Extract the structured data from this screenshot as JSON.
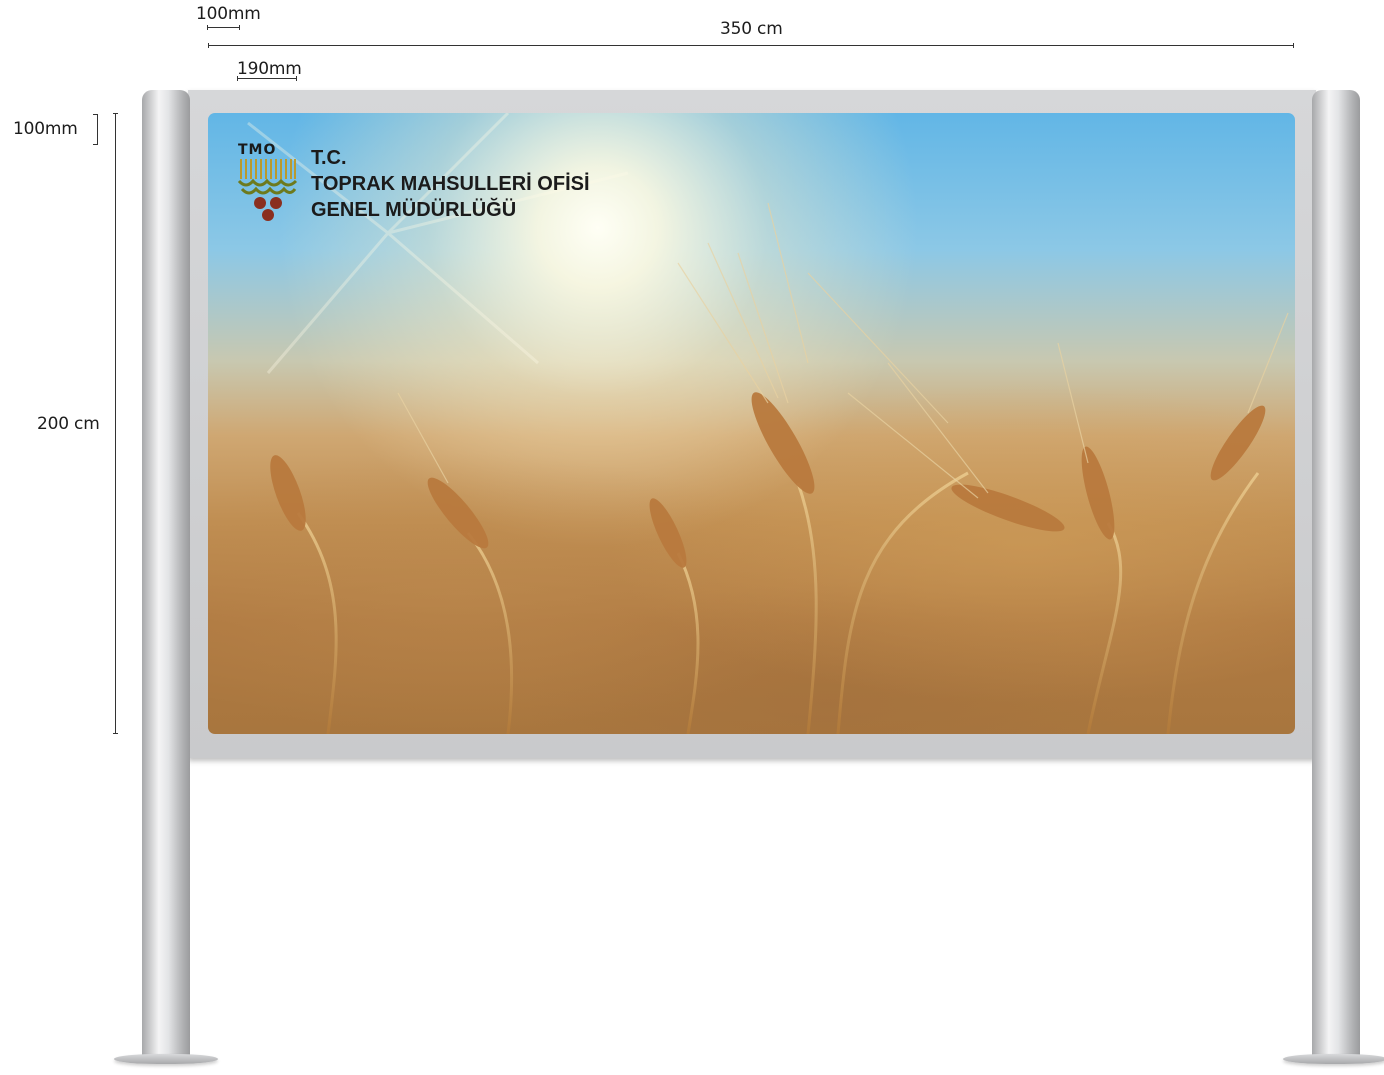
{
  "dimensions": {
    "top_small_width": "100mm",
    "total_width": "350 cm",
    "post_offset": "190mm",
    "frame_thickness": "100mm",
    "panel_height": "200 cm"
  },
  "sign": {
    "logo_text": "TMO",
    "line1": "T.C.",
    "line2": "TOPRAK MAHSULLERİ OFİSİ",
    "line3": "GENEL MÜDÜRLÜĞÜ"
  },
  "colors": {
    "frame": "#cfd0d2",
    "post": "#e3e4e6",
    "sky": "#62b6e6",
    "wheat": "#c08e52",
    "logo_gold": "#b99a2e",
    "logo_green": "#6d7a1e",
    "logo_brown": "#8a2f1f"
  }
}
